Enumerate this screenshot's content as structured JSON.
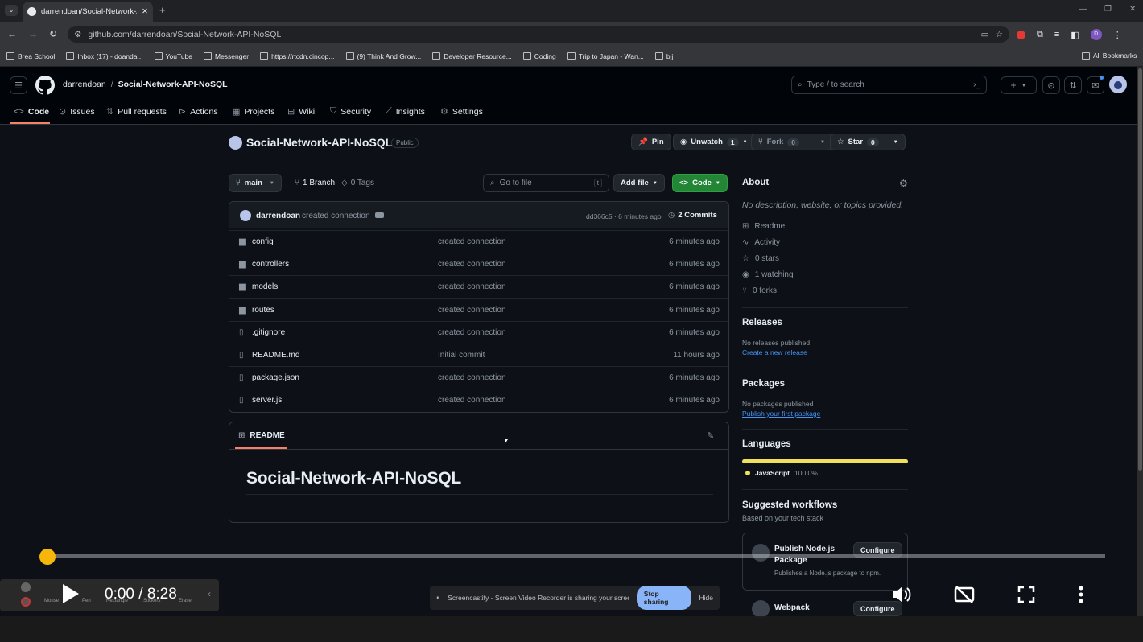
{
  "browser": {
    "tab_title": "darrendoan/Social-Network-AP",
    "url": "github.com/darrendoan/Social-Network-API-NoSQL",
    "profile_initial": "D",
    "bookmarks": [
      "Brea School",
      "Inbox (17) - doanda...",
      "YouTube",
      "Messenger",
      "https://rtcdn.cincop...",
      "(9) Think And Grow...",
      "Developer Resource...",
      "Coding",
      "Trip to Japan - Wan...",
      "bjj"
    ],
    "all_bookmarks": "All Bookmarks"
  },
  "header": {
    "owner": "darrendoan",
    "repo": "Social-Network-API-NoSQL",
    "search_placeholder": "Type / to search",
    "nav": [
      "Code",
      "Issues",
      "Pull requests",
      "Actions",
      "Projects",
      "Wiki",
      "Security",
      "Insights",
      "Settings"
    ]
  },
  "repo": {
    "name": "Social-Network-API-NoSQL",
    "visibility": "Public",
    "pin": "Pin",
    "unwatch": "Unwatch",
    "unwatch_count": "1",
    "fork": "Fork",
    "fork_count": "0",
    "star": "Star",
    "star_count": "0",
    "branch": "main",
    "branches": "1 Branch",
    "tags": "0 Tags",
    "goto_placeholder": "Go to file",
    "goto_key": "t",
    "add_file": "Add file",
    "code_btn": "Code"
  },
  "commit": {
    "author": "darrendoan",
    "message": "created connection",
    "hash_time": "dd366c5 · 6 minutes ago",
    "commits": "2 Commits"
  },
  "files": [
    {
      "name": "config",
      "type": "dir",
      "msg": "created connection",
      "time": "6 minutes ago"
    },
    {
      "name": "controllers",
      "type": "dir",
      "msg": "created connection",
      "time": "6 minutes ago"
    },
    {
      "name": "models",
      "type": "dir",
      "msg": "created connection",
      "time": "6 minutes ago"
    },
    {
      "name": "routes",
      "type": "dir",
      "msg": "created connection",
      "time": "6 minutes ago"
    },
    {
      "name": ".gitignore",
      "type": "file",
      "msg": "created connection",
      "time": "6 minutes ago"
    },
    {
      "name": "README.md",
      "type": "file",
      "msg": "Initial commit",
      "time": "11 hours ago"
    },
    {
      "name": "package.json",
      "type": "file",
      "msg": "created connection",
      "time": "6 minutes ago"
    },
    {
      "name": "server.js",
      "type": "file",
      "msg": "created connection",
      "time": "6 minutes ago"
    }
  ],
  "readme": {
    "tab": "README",
    "heading": "Social-Network-API-NoSQL"
  },
  "about": {
    "title": "About",
    "desc": "No description, website, or topics provided.",
    "items": [
      "Readme",
      "Activity",
      "0 stars",
      "1 watching",
      "0 forks"
    ]
  },
  "releases": {
    "title": "Releases",
    "none": "No releases published",
    "link": "Create a new release"
  },
  "packages": {
    "title": "Packages",
    "none": "No packages published",
    "link": "Publish your first package"
  },
  "languages": {
    "title": "Languages",
    "name": "JavaScript",
    "pct": "100.0%",
    "color": "#f1e05a"
  },
  "workflows": {
    "title": "Suggested workflows",
    "sub": "Based on your tech stack",
    "items": [
      {
        "name": "Publish Node.js Package",
        "desc": "Publishes a Node.js package to npm.",
        "btn": "Configure"
      },
      {
        "name": "Webpack",
        "btn": "Configure"
      }
    ]
  },
  "video": {
    "time": "0:00 / 8:28",
    "progress": 0
  },
  "screencastify": {
    "text": "Screencastify - Screen Video Recorder is sharing your screen.",
    "stop": "Stop sharing",
    "hide": "Hide"
  },
  "drawtools": [
    "Mouse",
    "Pen",
    "Rectangle",
    "Stickers",
    "Eraser"
  ],
  "colors": {
    "accent": "#f78166",
    "green": "#238636",
    "link": "#4493f8",
    "knob": "#f6b60a"
  }
}
